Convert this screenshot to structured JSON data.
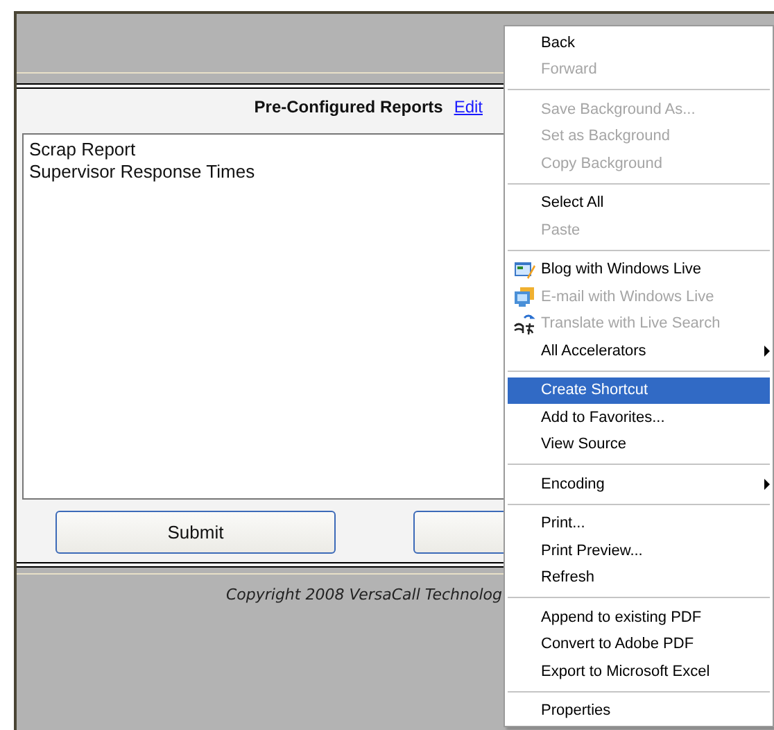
{
  "panel": {
    "heading": "Pre-Configured Reports",
    "edit_link": "Edit"
  },
  "reports": [
    {
      "label": "Scrap Report"
    },
    {
      "label": "Supervisor Response Times"
    }
  ],
  "submit_button": "Submit",
  "footer": {
    "copyright": "Copyright 2008 VersaCall Technolog"
  },
  "context_menu": {
    "groups": [
      [
        {
          "label": "Back",
          "disabled": false,
          "selected": false,
          "submenu": false,
          "icon": false
        },
        {
          "label": "Forward",
          "disabled": true,
          "selected": false,
          "submenu": false,
          "icon": false
        }
      ],
      [
        {
          "label": "Save Background As...",
          "disabled": true,
          "selected": false,
          "submenu": false,
          "icon": false
        },
        {
          "label": "Set as Background",
          "disabled": true,
          "selected": false,
          "submenu": false,
          "icon": false
        },
        {
          "label": "Copy Background",
          "disabled": true,
          "selected": false,
          "submenu": false,
          "icon": false
        }
      ],
      [
        {
          "label": "Select All",
          "disabled": false,
          "selected": false,
          "submenu": false,
          "icon": false
        },
        {
          "label": "Paste",
          "disabled": true,
          "selected": false,
          "submenu": false,
          "icon": false
        }
      ],
      [
        {
          "label": "Blog with Windows Live",
          "disabled": false,
          "selected": false,
          "submenu": false,
          "icon": true
        },
        {
          "label": "E-mail with Windows Live",
          "disabled": true,
          "selected": false,
          "submenu": false,
          "icon": true
        },
        {
          "label": "Translate with Live Search",
          "disabled": true,
          "selected": false,
          "submenu": false,
          "icon": true
        },
        {
          "label": "All Accelerators",
          "disabled": false,
          "selected": false,
          "submenu": true,
          "icon": false
        }
      ],
      [
        {
          "label": "Create Shortcut",
          "disabled": false,
          "selected": true,
          "submenu": false,
          "icon": false
        },
        {
          "label": "Add to Favorites...",
          "disabled": false,
          "selected": false,
          "submenu": false,
          "icon": false
        },
        {
          "label": "View Source",
          "disabled": false,
          "selected": false,
          "submenu": false,
          "icon": false
        }
      ],
      [
        {
          "label": "Encoding",
          "disabled": false,
          "selected": false,
          "submenu": true,
          "icon": false
        }
      ],
      [
        {
          "label": "Print...",
          "disabled": false,
          "selected": false,
          "submenu": false,
          "icon": false
        },
        {
          "label": "Print Preview...",
          "disabled": false,
          "selected": false,
          "submenu": false,
          "icon": false
        },
        {
          "label": "Refresh",
          "disabled": false,
          "selected": false,
          "submenu": false,
          "icon": false
        }
      ],
      [
        {
          "label": "Append to existing PDF",
          "disabled": false,
          "selected": false,
          "submenu": false,
          "icon": false
        },
        {
          "label": "Convert to Adobe PDF",
          "disabled": false,
          "selected": false,
          "submenu": false,
          "icon": false
        },
        {
          "label": "Export to Microsoft Excel",
          "disabled": false,
          "selected": false,
          "submenu": false,
          "icon": false
        }
      ],
      [
        {
          "label": "Properties",
          "disabled": false,
          "selected": false,
          "submenu": false,
          "icon": false
        }
      ]
    ]
  }
}
